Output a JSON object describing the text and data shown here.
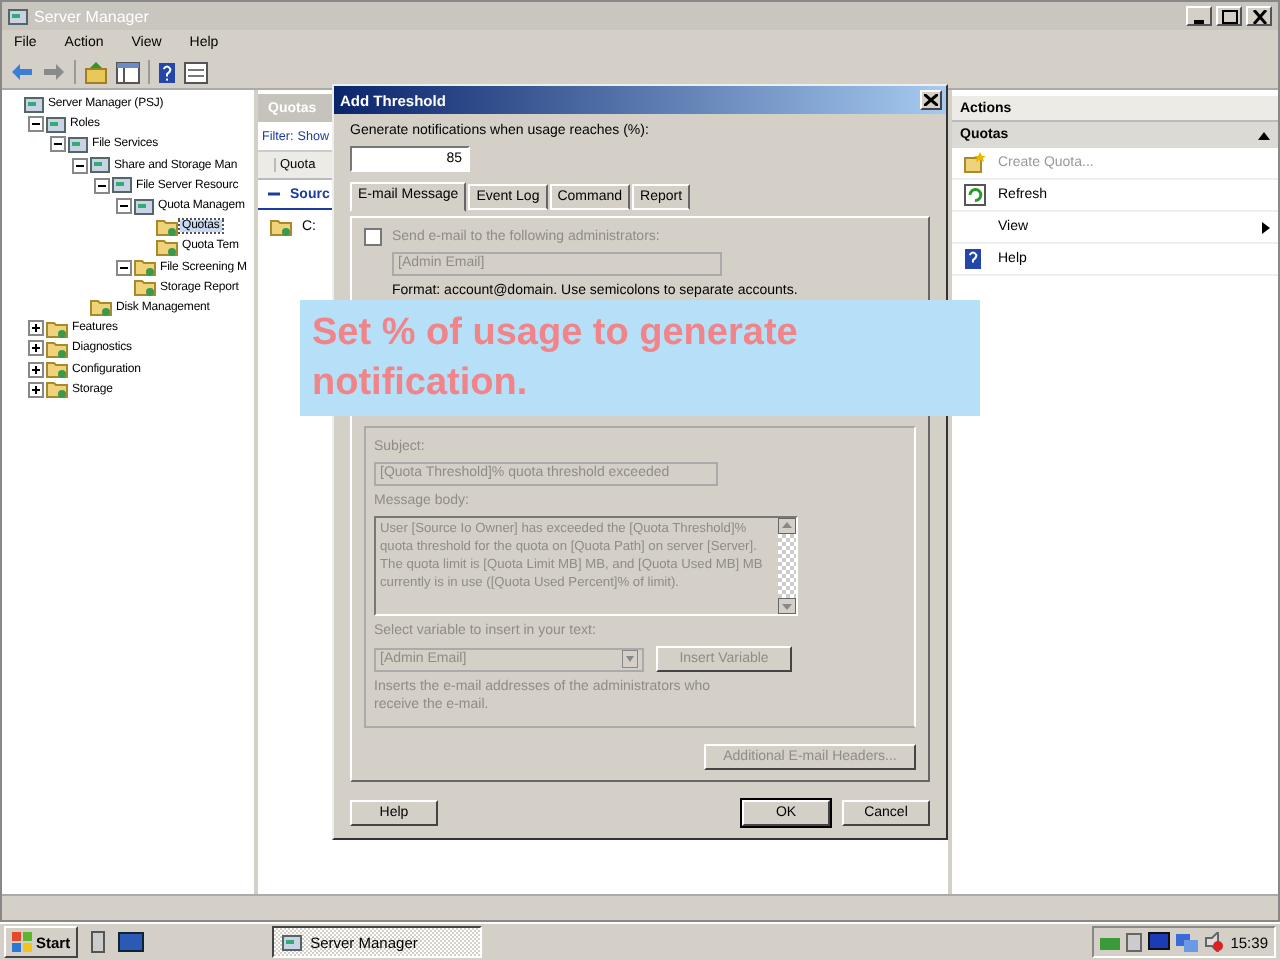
{
  "window": {
    "title": "Server Manager",
    "menu": [
      "File",
      "Action",
      "View",
      "Help"
    ]
  },
  "tree": {
    "items": [
      {
        "label": "Server Manager (PSJ)",
        "selected": false,
        "children": [
          {
            "label": "Roles",
            "selected": false,
            "expanded": true,
            "children": [
              {
                "label": "File Services",
                "selected": false,
                "expanded": true,
                "children": [
                  {
                    "label": "Share and Storage Man",
                    "selected": false,
                    "expanded": true,
                    "children": [
                      {
                        "label": "File Server Resourc",
                        "selected": false,
                        "expanded": true,
                        "children": [
                          {
                            "label": "Quota Managem",
                            "selected": false,
                            "expanded": true,
                            "children": [
                              {
                                "label": "Quotas",
                                "selected": true
                              },
                              {
                                "label": "Quota Tem",
                                "selected": false
                              }
                            ]
                          },
                          {
                            "label": "File Screening M",
                            "selected": false,
                            "expanded": true
                          },
                          {
                            "label": "Storage Report",
                            "selected": false
                          }
                        ]
                      }
                    ]
                  },
                  {
                    "label": "Disk Management",
                    "selected": false
                  }
                ]
              }
            ]
          },
          {
            "label": "Features",
            "selected": false,
            "expanded": false
          },
          {
            "label": "Diagnostics",
            "selected": false,
            "expanded": false
          },
          {
            "label": "Configuration",
            "selected": false,
            "expanded": false
          },
          {
            "label": "Storage",
            "selected": false,
            "expanded": false
          }
        ]
      }
    ]
  },
  "quotas_pane": {
    "title": "Quotas",
    "filter_label": "Filter:",
    "filter_value": "Show",
    "columns": [
      "Quota"
    ],
    "group": "Sourc",
    "rows": [
      "C:"
    ]
  },
  "actions": {
    "title": "Actions",
    "section": "Quotas",
    "items": [
      {
        "label": "Create Quota...",
        "disabled": true,
        "submenu": false
      },
      {
        "label": "Refresh",
        "disabled": false,
        "submenu": false
      },
      {
        "label": "View",
        "disabled": false,
        "submenu": true
      },
      {
        "label": "Help",
        "disabled": false,
        "submenu": false
      }
    ]
  },
  "dialog": {
    "title": "Add Threshold",
    "usage_label": "Generate notifications when usage reaches (%):",
    "usage_value": "85",
    "tabs": [
      {
        "label": "E-mail Message",
        "selected": true
      },
      {
        "label": "Event Log",
        "selected": false
      },
      {
        "label": "Command",
        "selected": false
      },
      {
        "label": "Report",
        "selected": false
      }
    ],
    "send_admins": {
      "label": "Send e-mail to the following administrators:",
      "checked": false
    },
    "admins_value": "[Admin Email]",
    "format_hint": "Format: account@domain. Use semicolons to separate accounts.",
    "email_disabled": true,
    "subject_label": "Subject:",
    "subject_value": "[Quota Threshold]% quota threshold exceeded",
    "body_label": "Message body:",
    "body_value": "User [Source Io Owner] has exceeded the [Quota Threshold]% quota threshold for the quota on [Quota Path] on server [Server]. The quota limit is [Quota Limit MB] MB, and [Quota Used MB] MB currently is in use ([Quota Used Percent]% of limit).",
    "variable_label": "Select variable to insert in your text:",
    "variable_value": "[Admin Email]",
    "insert_button": "Insert Variable",
    "variable_hint": "Inserts the e-mail addresses of the administrators who receive the e-mail.",
    "headers_button": "Additional E-mail Headers...",
    "buttons": {
      "help": "Help",
      "ok": "OK",
      "cancel": "Cancel"
    }
  },
  "callout": "Set % of usage to generate notification.",
  "taskbar": {
    "start": "Start",
    "task": {
      "label": "Server Manager",
      "selected": true
    },
    "clock": "15:39"
  }
}
